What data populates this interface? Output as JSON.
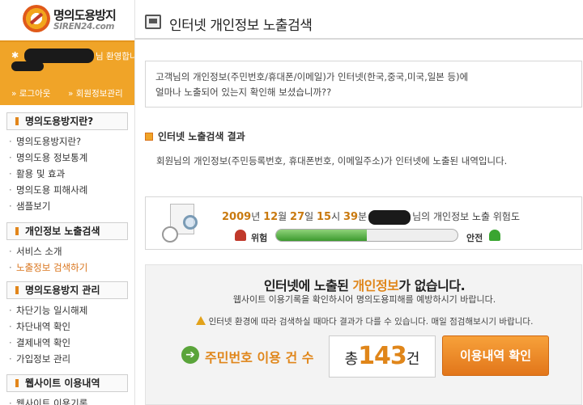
{
  "brand": {
    "name": "명의도용방지",
    "url": "SIREN24.com"
  },
  "user": {
    "welcome_suffix": "님 환영합니다.",
    "logout": "» 로그아웃",
    "account": "» 회원정보관리"
  },
  "sidebar": {
    "sections": [
      {
        "title": "명의도용방지란?",
        "items": [
          "명의도용방지란?",
          "명의도용 정보통계",
          "활용 및 효과",
          "명의도용 피해사례",
          "샘플보기"
        ]
      },
      {
        "title": "개인정보 노출검색",
        "items": [
          "서비스 소개",
          "노출정보 검색하기"
        ]
      },
      {
        "title": "명의도용방지 관리",
        "items": [
          "차단기능 일시해제",
          "차단내역 확인",
          "결제내역 확인",
          "가입정보 관리"
        ]
      },
      {
        "title": "웹사이트 이용내역",
        "items": [
          "웹사이트 이용기록"
        ]
      }
    ]
  },
  "main": {
    "title": "인터넷 개인정보 노출검색",
    "intro_line1": "고객님의 개인정보(주민번호/휴대폰/이메일)가 인터넷(한국,중국,미국,일본 등)에",
    "intro_line2": "얼마나 노출되어 있는지 확인해 보셨습니까??",
    "result_heading": "인터넷 노출검색 결과",
    "result_desc": "회원님의 개인정보(주민등록번호, 휴대폰번호, 이메일주소)가 인터넷에 노출된 내역입니다.",
    "risk": {
      "year": "2009",
      "year_unit": "년",
      "month": "12",
      "month_unit": "월",
      "day": "27",
      "day_unit": "일",
      "hour": "15",
      "hour_unit": "시",
      "minute": "39",
      "minute_unit": "분",
      "suffix": "님의 개인정보 노출 위험도",
      "danger_label": "위험",
      "safe_label": "안전",
      "level_fraction": 0.5
    },
    "found": {
      "title_pre": "인터넷에 노출된 ",
      "title_hl": "개인정보",
      "title_post": "가 없습니다.",
      "sub": "웹사이트 이용기록을 확인하시어 명의도용피해를 예방하시기 바랍니다.",
      "warning": "인터넷 환경에 따라 검색하실 때마다 결과가 다를 수 있습니다. 매일 점검해보시기 바랍니다.",
      "count_label": "주민번호 이용 건 수",
      "count_prefix": "총",
      "count": "143",
      "count_suffix": "건",
      "history_button": "이용내역 확인"
    }
  },
  "colors": {
    "accent": "#f0a428",
    "highlight": "#e0861a",
    "gauge": "#3c9a2e"
  }
}
